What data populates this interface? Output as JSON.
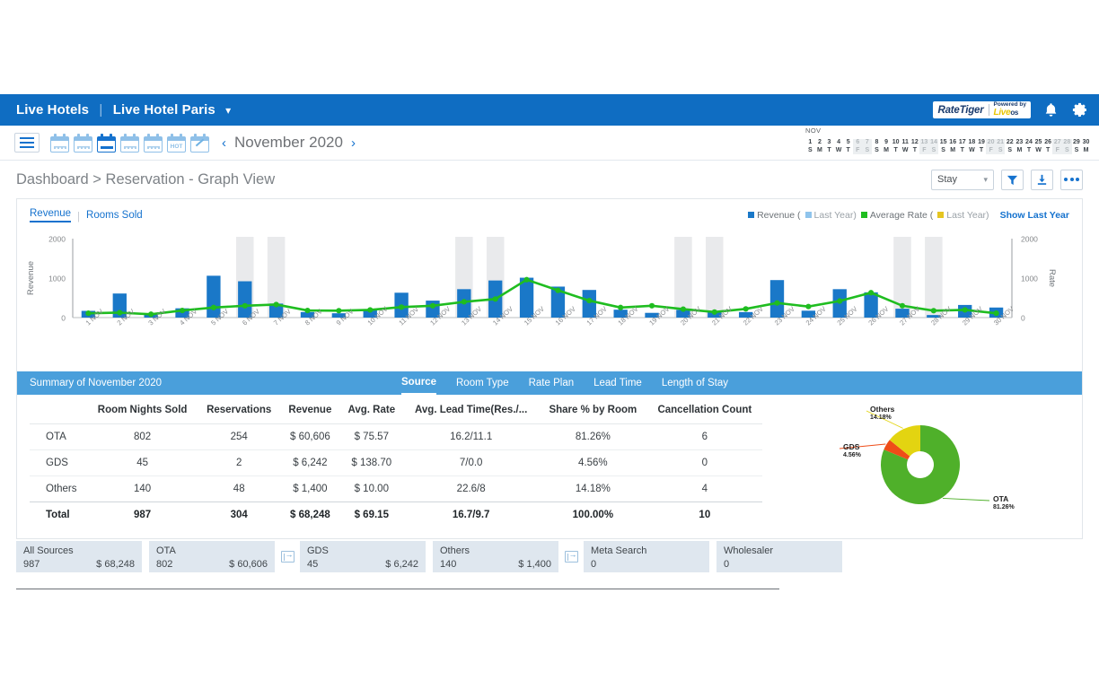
{
  "topbar": {
    "account": "Live Hotels",
    "separator": "|",
    "property": "Live Hotel Paris",
    "chevron": "⌄",
    "logo_name": "RateTiger",
    "logo_powered": "Powered by",
    "logo_live": "Live",
    "logo_os": "os",
    "bell_icon": "bell-icon",
    "gear_icon": "gear-icon"
  },
  "toolbar": {
    "menu_icon": "hamburger-icon",
    "prev": "‹",
    "next": "›",
    "month_label": "November 2020",
    "calendar_icons": [
      "calendar-list-icon",
      "calendar-grid-icon",
      "calendar-month-icon",
      "calendar-week-icon",
      "calendar-table-icon",
      "calendar-hot-icon",
      "calendar-edit-icon"
    ],
    "hot_label": "HOT"
  },
  "daystrip": {
    "month": "NOV",
    "days": [
      {
        "n": "1",
        "w": "S",
        "weekend": false
      },
      {
        "n": "2",
        "w": "M",
        "weekend": false
      },
      {
        "n": "3",
        "w": "T",
        "weekend": false
      },
      {
        "n": "4",
        "w": "W",
        "weekend": false
      },
      {
        "n": "5",
        "w": "T",
        "weekend": false
      },
      {
        "n": "6",
        "w": "F",
        "weekend": true
      },
      {
        "n": "7",
        "w": "S",
        "weekend": true
      },
      {
        "n": "8",
        "w": "S",
        "weekend": false
      },
      {
        "n": "9",
        "w": "M",
        "weekend": false
      },
      {
        "n": "10",
        "w": "T",
        "weekend": false
      },
      {
        "n": "11",
        "w": "W",
        "weekend": false
      },
      {
        "n": "12",
        "w": "T",
        "weekend": false
      },
      {
        "n": "13",
        "w": "F",
        "weekend": true
      },
      {
        "n": "14",
        "w": "S",
        "weekend": true
      },
      {
        "n": "15",
        "w": "S",
        "weekend": false
      },
      {
        "n": "16",
        "w": "M",
        "weekend": false
      },
      {
        "n": "17",
        "w": "T",
        "weekend": false
      },
      {
        "n": "18",
        "w": "W",
        "weekend": false
      },
      {
        "n": "19",
        "w": "T",
        "weekend": false
      },
      {
        "n": "20",
        "w": "F",
        "weekend": true
      },
      {
        "n": "21",
        "w": "S",
        "weekend": true
      },
      {
        "n": "22",
        "w": "S",
        "weekend": false
      },
      {
        "n": "23",
        "w": "M",
        "weekend": false
      },
      {
        "n": "24",
        "w": "T",
        "weekend": false
      },
      {
        "n": "25",
        "w": "W",
        "weekend": false
      },
      {
        "n": "26",
        "w": "T",
        "weekend": false
      },
      {
        "n": "27",
        "w": "F",
        "weekend": true
      },
      {
        "n": "28",
        "w": "S",
        "weekend": true
      },
      {
        "n": "29",
        "w": "S",
        "weekend": false
      },
      {
        "n": "30",
        "w": "M",
        "weekend": false
      }
    ]
  },
  "breadcrumb": "Dashboard > Reservation - Graph View",
  "page_tools": {
    "stay_select_value": "Stay",
    "stay_chevron": "⌄",
    "filter_icon": "filter-funnel-icon",
    "download_icon": "download-icon",
    "more_icon": "more-options-icon"
  },
  "view_tabs": {
    "revenue": "Revenue",
    "divider": "|",
    "rooms_sold": "Rooms Sold"
  },
  "legend": {
    "revenue": "Revenue (",
    "revenue_ly": "Last Year)",
    "avg_rate": "Average Rate (",
    "avg_rate_ly": "Last Year)",
    "show_last_year": "Show Last Year",
    "color_revenue": "#1a78c8",
    "color_revenue_ly": "#8fc4ec",
    "color_rate": "#1fbd20",
    "color_rate_ly": "#e5c521"
  },
  "chart_data": {
    "type": "bar",
    "title": "",
    "xlabel": "",
    "ylabel": "Revenue",
    "y2label": "Rate",
    "ylim": [
      0,
      2000
    ],
    "y2lim": [
      0,
      2000
    ],
    "yticks": [
      0,
      1000,
      2000
    ],
    "y2ticks": [
      0,
      1000,
      2000
    ],
    "grid": false,
    "legend_position": "top-right",
    "categories": [
      "1 NOV",
      "2 NOV",
      "3 NOV",
      "4 NOV",
      "5 NOV",
      "6 NOV",
      "7 NOV",
      "8 NOV",
      "9 NOV",
      "10 NOV",
      "11 NOV",
      "12 NOV",
      "13 NOV",
      "14 NOV",
      "15 NOV",
      "16 NOV",
      "17 NOV",
      "18 NOV",
      "19 NOV",
      "20 NOV",
      "21 NOV",
      "22 NOV",
      "23 NOV",
      "24 NOV",
      "25 NOV",
      "26 NOV",
      "27 NOV",
      "28 NOV",
      "29 NOV",
      "30 NOV"
    ],
    "series": [
      {
        "name": "Revenue",
        "type": "bar",
        "color": "#1a78c8",
        "axis": "left",
        "values": [
          170,
          610,
          95,
          235,
          1060,
          920,
          355,
          140,
          110,
          200,
          630,
          430,
          720,
          940,
          1010,
          785,
          700,
          200,
          120,
          195,
          165,
          140,
          950,
          175,
          720,
          640,
          225,
          65,
          320,
          255
        ]
      },
      {
        "name": "Average Rate",
        "type": "line",
        "color": "#1fbd20",
        "axis": "right",
        "values": [
          110,
          125,
          85,
          180,
          255,
          300,
          330,
          180,
          175,
          195,
          265,
          300,
          400,
          470,
          960,
          690,
          430,
          255,
          300,
          215,
          140,
          220,
          370,
          280,
          420,
          630,
          300,
          175,
          195,
          110
        ]
      }
    ],
    "weekend_bands": [
      "6 NOV",
      "7 NOV",
      "13 NOV",
      "14 NOV",
      "20 NOV",
      "21 NOV",
      "27 NOV",
      "28 NOV"
    ],
    "weekend_band_color": "#e9eaec"
  },
  "summary": {
    "title": "Summary of November 2020",
    "tabs": [
      {
        "label": "Source",
        "active": true
      },
      {
        "label": "Room Type",
        "active": false
      },
      {
        "label": "Rate Plan",
        "active": false
      },
      {
        "label": "Lead Time",
        "active": false
      },
      {
        "label": "Length of Stay",
        "active": false
      }
    ],
    "columns": [
      "",
      "Room Nights Sold",
      "Reservations",
      "Revenue",
      "Avg. Rate",
      "Avg. Lead Time(Res./...",
      "Share % by Room",
      "Cancellation Count"
    ],
    "rows": [
      {
        "source": "OTA",
        "room_nights_sold": "802",
        "reservations": "254",
        "revenue": "$ 60,606",
        "avg_rate": "$ 75.57",
        "avg_lead_time": "16.2/11.1",
        "share": "81.26%",
        "cancellations": "6"
      },
      {
        "source": "GDS",
        "room_nights_sold": "45",
        "reservations": "2",
        "revenue": "$ 6,242",
        "avg_rate": "$ 138.70",
        "avg_lead_time": "7/0.0",
        "share": "4.56%",
        "cancellations": "0"
      },
      {
        "source": "Others",
        "room_nights_sold": "140",
        "reservations": "48",
        "revenue": "$ 1,400",
        "avg_rate": "$ 10.00",
        "avg_lead_time": "22.6/8",
        "share": "14.18%",
        "cancellations": "4"
      }
    ],
    "total": {
      "source": "Total",
      "room_nights_sold": "987",
      "reservations": "304",
      "revenue": "$ 68,248",
      "avg_rate": "$ 69.15",
      "avg_lead_time": "16.7/9.7",
      "share": "100.00%",
      "cancellations": "10"
    }
  },
  "donut_chart": {
    "type": "pie",
    "title": "",
    "labels": [
      "OTA",
      "GDS",
      "Others"
    ],
    "values": [
      81.26,
      4.56,
      14.18
    ],
    "value_labels": [
      "81.26%",
      "4.56%",
      "14.18%"
    ],
    "colors": [
      "#4fb02a",
      "#ef4c18",
      "#e3d411"
    ]
  },
  "bottom_cards": [
    {
      "title": "All Sources",
      "count": "987",
      "amount": "$ 68,248"
    },
    {
      "title": "OTA",
      "count": "802",
      "amount": "$ 60,606"
    },
    {
      "title": "GDS",
      "count": "45",
      "amount": "$ 6,242"
    },
    {
      "title": "Others",
      "count": "140",
      "amount": "$ 1,400"
    },
    {
      "title": "Meta Search",
      "count": "0",
      "amount": ""
    },
    {
      "title": "Wholesaler",
      "count": "0",
      "amount": ""
    }
  ],
  "expand_icon": "expand-panel-icon"
}
